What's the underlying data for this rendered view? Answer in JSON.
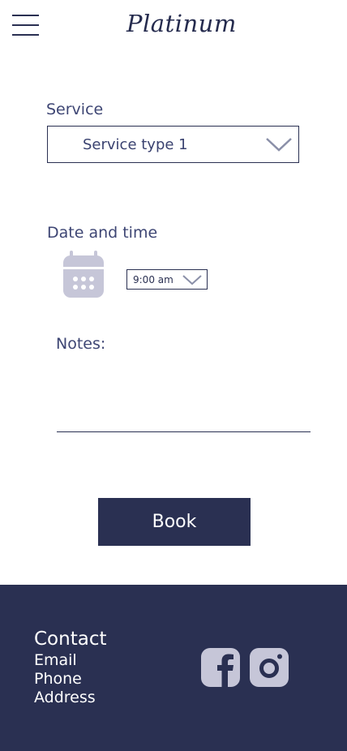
{
  "header": {
    "logo_text": "Platinum",
    "menu_icon": "hamburger-menu-icon"
  },
  "form": {
    "service_label": "Service",
    "service_value": "Service type 1",
    "date_time_label": "Date and time",
    "calendar_icon": "calendar-icon",
    "time_value": "9:00 am",
    "notes_label": "Notes:",
    "notes_value": ""
  },
  "book_button": {
    "label": "Book"
  },
  "footer": {
    "contact_title": "Contact",
    "links": [
      "Email",
      "Phone",
      "Address"
    ],
    "social_icons": [
      "facebook-icon",
      "instagram-icon"
    ]
  },
  "colors": {
    "primary": "#2a3052",
    "icon_muted": "#c6c6d8",
    "background": "#ffffff"
  }
}
